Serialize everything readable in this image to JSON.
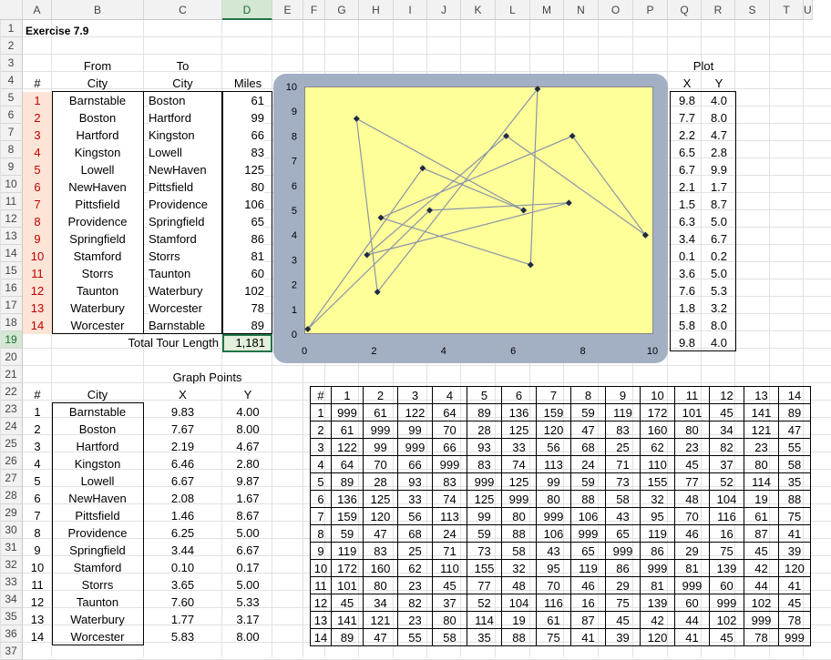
{
  "columns": [
    "A",
    "B",
    "C",
    "D",
    "E",
    "F",
    "G",
    "H",
    "I",
    "J",
    "K",
    "L",
    "M",
    "N",
    "O",
    "P",
    "Q",
    "R",
    "S",
    "T",
    "U"
  ],
  "selected_column": "D",
  "rows": [
    "1",
    "2",
    "3",
    "4",
    "5",
    "6",
    "7",
    "8",
    "9",
    "10",
    "11",
    "12",
    "13",
    "14",
    "15",
    "16",
    "17",
    "18",
    "19",
    "20",
    "21",
    "22",
    "23",
    "24",
    "25",
    "26",
    "27",
    "28",
    "29",
    "30",
    "31",
    "32",
    "33",
    "34",
    "35",
    "36",
    "37"
  ],
  "selected_row": "19",
  "title": "Exercise 7.9",
  "tour": {
    "header_from": "From",
    "header_to": "To",
    "header_num": "#",
    "header_city": "City",
    "header_city2": "City",
    "header_miles": "Miles",
    "rows": [
      {
        "num": "1",
        "from": "Barnstable",
        "to": "Boston",
        "miles": "61"
      },
      {
        "num": "2",
        "from": "Boston",
        "to": "Hartford",
        "miles": "99"
      },
      {
        "num": "3",
        "from": "Hartford",
        "to": "Kingston",
        "miles": "66"
      },
      {
        "num": "4",
        "from": "Kingston",
        "to": "Lowell",
        "miles": "83"
      },
      {
        "num": "5",
        "from": "Lowell",
        "to": "NewHaven",
        "miles": "125"
      },
      {
        "num": "6",
        "from": "NewHaven",
        "to": "Pittsfield",
        "miles": "80"
      },
      {
        "num": "7",
        "from": "Pittsfield",
        "to": "Providence",
        "miles": "106"
      },
      {
        "num": "8",
        "from": "Providence",
        "to": "Springfield",
        "miles": "65"
      },
      {
        "num": "9",
        "from": "Springfield",
        "to": "Stamford",
        "miles": "86"
      },
      {
        "num": "10",
        "from": "Stamford",
        "to": "Storrs",
        "miles": "81"
      },
      {
        "num": "11",
        "from": "Storrs",
        "to": "Taunton",
        "miles": "60"
      },
      {
        "num": "12",
        "from": "Taunton",
        "to": "Waterbury",
        "miles": "102"
      },
      {
        "num": "13",
        "from": "Waterbury",
        "to": "Worcester",
        "miles": "78"
      },
      {
        "num": "14",
        "from": "Worcester",
        "to": "Barnstable",
        "miles": "89"
      }
    ],
    "total_label": "Total Tour Length",
    "total_value": "1,181"
  },
  "plot": {
    "header": "Plot",
    "header_x": "X",
    "header_y": "Y",
    "rows": [
      [
        "9.8",
        "4.0"
      ],
      [
        "7.7",
        "8.0"
      ],
      [
        "2.2",
        "4.7"
      ],
      [
        "6.5",
        "2.8"
      ],
      [
        "6.7",
        "9.9"
      ],
      [
        "2.1",
        "1.7"
      ],
      [
        "1.5",
        "8.7"
      ],
      [
        "6.3",
        "5.0"
      ],
      [
        "3.4",
        "6.7"
      ],
      [
        "0.1",
        "0.2"
      ],
      [
        "3.6",
        "5.0"
      ],
      [
        "7.6",
        "5.3"
      ],
      [
        "1.8",
        "3.2"
      ],
      [
        "5.8",
        "8.0"
      ],
      [
        "9.8",
        "4.0"
      ]
    ]
  },
  "graph_points": {
    "title": "Graph Points",
    "header_num": "#",
    "header_city": "City",
    "header_x": "X",
    "header_y": "Y",
    "rows": [
      {
        "num": "1",
        "city": "Barnstable",
        "x": "9.83",
        "y": "4.00"
      },
      {
        "num": "2",
        "city": "Boston",
        "x": "7.67",
        "y": "8.00"
      },
      {
        "num": "3",
        "city": "Hartford",
        "x": "2.19",
        "y": "4.67"
      },
      {
        "num": "4",
        "city": "Kingston",
        "x": "6.46",
        "y": "2.80"
      },
      {
        "num": "5",
        "city": "Lowell",
        "x": "6.67",
        "y": "9.87"
      },
      {
        "num": "6",
        "city": "NewHaven",
        "x": "2.08",
        "y": "1.67"
      },
      {
        "num": "7",
        "city": "Pittsfield",
        "x": "1.46",
        "y": "8.67"
      },
      {
        "num": "8",
        "city": "Providence",
        "x": "6.25",
        "y": "5.00"
      },
      {
        "num": "9",
        "city": "Springfield",
        "x": "3.44",
        "y": "6.67"
      },
      {
        "num": "10",
        "city": "Stamford",
        "x": "0.10",
        "y": "0.17"
      },
      {
        "num": "11",
        "city": "Storrs",
        "x": "3.65",
        "y": "5.00"
      },
      {
        "num": "12",
        "city": "Taunton",
        "x": "7.60",
        "y": "5.33"
      },
      {
        "num": "13",
        "city": "Waterbury",
        "x": "1.77",
        "y": "3.17"
      },
      {
        "num": "14",
        "city": "Worcester",
        "x": "5.83",
        "y": "8.00"
      }
    ]
  },
  "matrix": {
    "corner": "#",
    "headers": [
      "1",
      "2",
      "3",
      "4",
      "5",
      "6",
      "7",
      "8",
      "9",
      "10",
      "11",
      "12",
      "13",
      "14"
    ],
    "rows": [
      [
        "1",
        "999",
        "61",
        "122",
        "64",
        "89",
        "136",
        "159",
        "59",
        "119",
        "172",
        "101",
        "45",
        "141",
        "89"
      ],
      [
        "2",
        "61",
        "999",
        "99",
        "70",
        "28",
        "125",
        "120",
        "47",
        "83",
        "160",
        "80",
        "34",
        "121",
        "47"
      ],
      [
        "3",
        "122",
        "99",
        "999",
        "66",
        "93",
        "33",
        "56",
        "68",
        "25",
        "62",
        "23",
        "82",
        "23",
        "55"
      ],
      [
        "4",
        "64",
        "70",
        "66",
        "999",
        "83",
        "74",
        "113",
        "24",
        "71",
        "110",
        "45",
        "37",
        "80",
        "58"
      ],
      [
        "5",
        "89",
        "28",
        "93",
        "83",
        "999",
        "125",
        "99",
        "59",
        "73",
        "155",
        "77",
        "52",
        "114",
        "35"
      ],
      [
        "6",
        "136",
        "125",
        "33",
        "74",
        "125",
        "999",
        "80",
        "88",
        "58",
        "32",
        "48",
        "104",
        "19",
        "88"
      ],
      [
        "7",
        "159",
        "120",
        "56",
        "113",
        "99",
        "80",
        "999",
        "106",
        "43",
        "95",
        "70",
        "116",
        "61",
        "75"
      ],
      [
        "8",
        "59",
        "47",
        "68",
        "24",
        "59",
        "88",
        "106",
        "999",
        "65",
        "119",
        "46",
        "16",
        "87",
        "41"
      ],
      [
        "9",
        "119",
        "83",
        "25",
        "71",
        "73",
        "58",
        "43",
        "65",
        "999",
        "86",
        "29",
        "75",
        "45",
        "39"
      ],
      [
        "10",
        "172",
        "160",
        "62",
        "110",
        "155",
        "32",
        "95",
        "119",
        "86",
        "999",
        "81",
        "139",
        "42",
        "120"
      ],
      [
        "11",
        "101",
        "80",
        "23",
        "45",
        "77",
        "48",
        "70",
        "46",
        "29",
        "81",
        "999",
        "60",
        "44",
        "41"
      ],
      [
        "12",
        "45",
        "34",
        "82",
        "37",
        "52",
        "104",
        "116",
        "16",
        "75",
        "139",
        "60",
        "999",
        "102",
        "45"
      ],
      [
        "13",
        "141",
        "121",
        "23",
        "80",
        "114",
        "19",
        "61",
        "87",
        "45",
        "42",
        "44",
        "102",
        "999",
        "78"
      ],
      [
        "14",
        "89",
        "47",
        "55",
        "58",
        "35",
        "88",
        "75",
        "41",
        "39",
        "120",
        "41",
        "45",
        "78",
        "999"
      ]
    ]
  },
  "chart_data": {
    "type": "scatter",
    "mode": "lines+markers",
    "xlim": [
      0,
      10
    ],
    "ylim": [
      0,
      10
    ],
    "x_ticks": [
      "0",
      "2",
      "4",
      "6",
      "8",
      "10"
    ],
    "y_ticks": [
      "0",
      "1",
      "2",
      "3",
      "4",
      "5",
      "6",
      "7",
      "8",
      "9",
      "10"
    ],
    "points": [
      [
        9.8,
        4.0
      ],
      [
        7.7,
        8.0
      ],
      [
        2.2,
        4.7
      ],
      [
        6.5,
        2.8
      ],
      [
        6.7,
        9.9
      ],
      [
        2.1,
        1.7
      ],
      [
        1.5,
        8.7
      ],
      [
        6.3,
        5.0
      ],
      [
        3.4,
        6.7
      ],
      [
        0.1,
        0.2
      ],
      [
        3.6,
        5.0
      ],
      [
        7.6,
        5.3
      ],
      [
        1.8,
        3.2
      ],
      [
        5.8,
        8.0
      ],
      [
        9.8,
        4.0
      ]
    ],
    "plot_bg": "#ffff99",
    "line_color": "#8a93a8",
    "marker_color": "#1f2a44"
  }
}
